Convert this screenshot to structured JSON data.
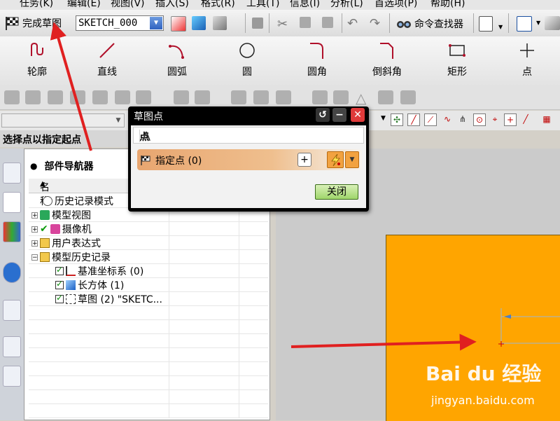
{
  "menubar": {
    "items": [
      "任务(K)",
      "编辑(E)",
      "视图(V)",
      "插入(S)",
      "格式(R)",
      "工具(T)",
      "信息(I)",
      "分析(L)",
      "首选项(P)",
      "帮助(H)"
    ]
  },
  "toolbar": {
    "finish_sketch_label": "完成草图",
    "sketch_name": "SKETCH_000",
    "command_finder_label": "命令查找器"
  },
  "sketch_tools": [
    "轮廓",
    "直线",
    "圆弧",
    "圆",
    "圆角",
    "倒斜角",
    "矩形",
    "点"
  ],
  "cue_line": "选择点以指定起点",
  "navigator": {
    "title": "部件导航器",
    "column_header": "名称",
    "rows": [
      {
        "label": "历史记录模式",
        "icon": "clock-icon"
      },
      {
        "label": "模型视图",
        "icon": "views-icon"
      },
      {
        "label": "摄像机",
        "icon": "camera-icon"
      },
      {
        "label": "用户表达式",
        "icon": "folder-icon"
      },
      {
        "label": "模型历史记录",
        "icon": "folder-icon"
      },
      {
        "label": "基准坐标系 (0)",
        "icon": "datum-csys-icon"
      },
      {
        "label": "长方体 (1)",
        "icon": "block-icon"
      },
      {
        "label": "草图 (2) \"SKETC...",
        "icon": "sketch-icon"
      }
    ]
  },
  "dialog": {
    "title": "草图点",
    "group_label": "点",
    "specify_point_label": "指定点 (0)",
    "close_label": "关闭"
  },
  "watermark": {
    "logo_text": "Bai du 经验",
    "url": "jingyan.baidu.com"
  },
  "colors": {
    "orange_face": "#ffa500",
    "arrow_red": "#e02020"
  }
}
